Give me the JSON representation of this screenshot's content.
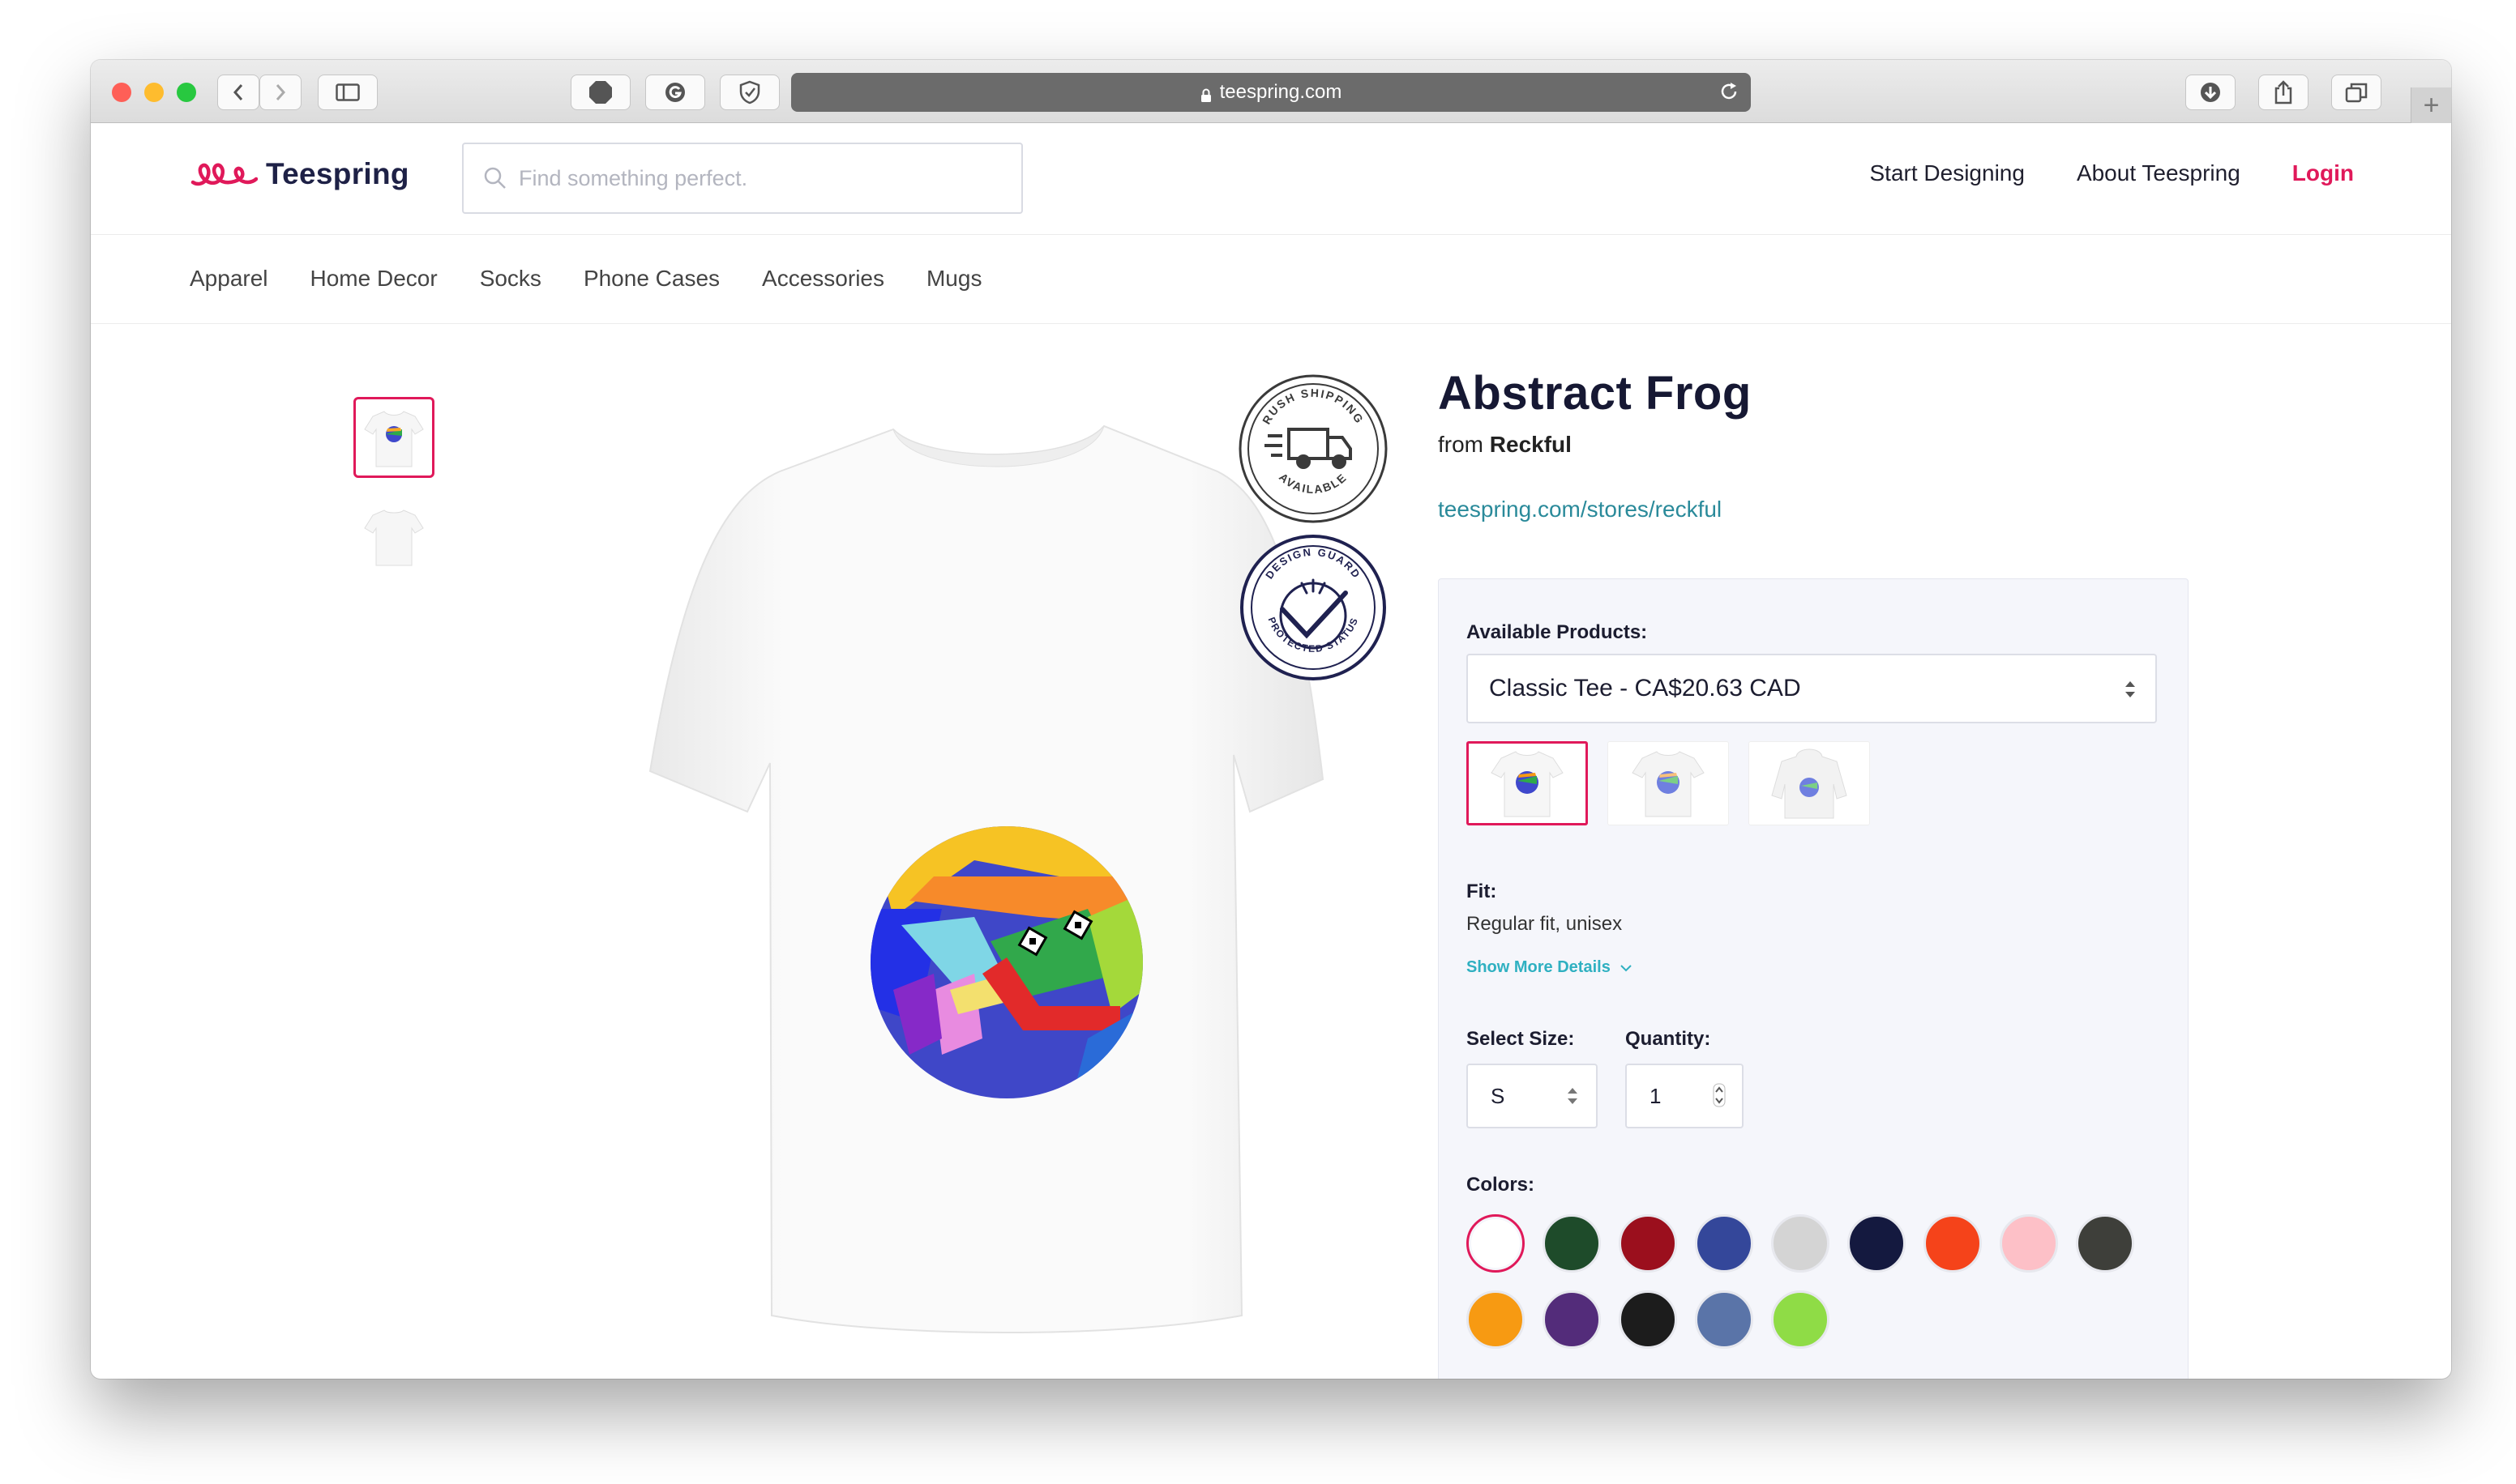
{
  "browser": {
    "url": "teespring.com"
  },
  "header": {
    "logo_text": "Teespring",
    "search_placeholder": "Find something perfect.",
    "nav": [
      "Start Designing",
      "About Teespring",
      "Login"
    ]
  },
  "categories": [
    "Apparel",
    "Home Decor",
    "Socks",
    "Phone Cases",
    "Accessories",
    "Mugs"
  ],
  "product": {
    "title": "Abstract Frog",
    "from_prefix": "from",
    "seller": "Reckful",
    "store_link": "teespring.com/stores/reckful"
  },
  "badges": {
    "rush_top": "RUSH SHIPPING",
    "rush_bottom": "AVAILABLE",
    "guard_top": "DESIGN GUARD",
    "guard_bottom": "PROTECTED STATUS"
  },
  "options": {
    "available_label": "Available Products:",
    "selected_product": "Classic Tee - CA$20.63 CAD",
    "fit_label": "Fit:",
    "fit_value": "Regular fit, unisex",
    "more_details": "Show More Details",
    "size_label": "Select Size:",
    "size_value": "S",
    "quantity_label": "Quantity:",
    "quantity_value": "1",
    "colors_label": "Colors:",
    "colors": [
      "#ffffff",
      "#1e4b2a",
      "#9b0f1d",
      "#34479a",
      "#d4d4d4",
      "#14193f",
      "#f5431a",
      "#fdc0c7",
      "#3e3f3a",
      "#f79a12",
      "#532c7a",
      "#1c1c1c",
      "#5a74a8",
      "#8fdc46"
    ],
    "selected_color": "#ffffff"
  },
  "theme": {
    "accent": "#e0195a",
    "link": "#2a8a9a"
  }
}
